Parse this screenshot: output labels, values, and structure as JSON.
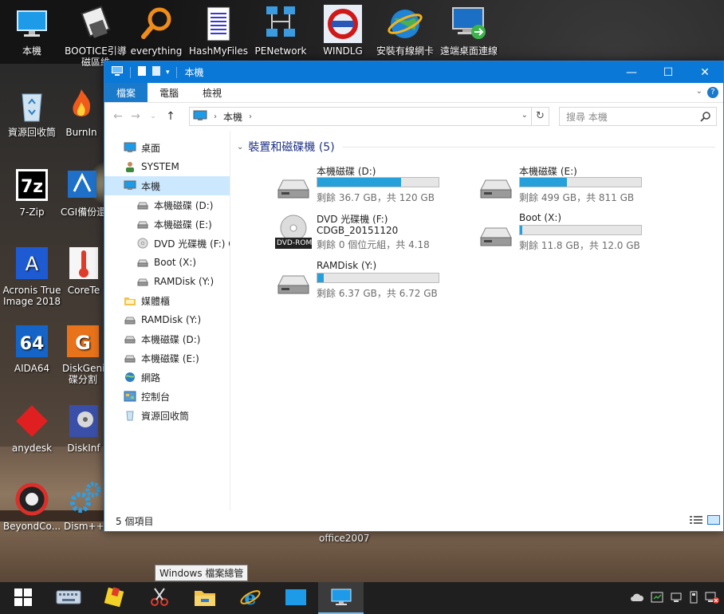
{
  "desktop": {
    "icons": [
      {
        "name": "this-pc",
        "label": "本機"
      },
      {
        "name": "bootice",
        "label": "BOOTICE引導磁區維"
      },
      {
        "name": "everything",
        "label": "everything"
      },
      {
        "name": "hashmyfiles",
        "label": "HashMyFiles"
      },
      {
        "name": "penetwork",
        "label": "PENetwork"
      },
      {
        "name": "windlg",
        "label": "WINDLG"
      },
      {
        "name": "install-nic",
        "label": "安裝有線網卡"
      },
      {
        "name": "remote-desktop",
        "label": "遠端桌面連線"
      },
      {
        "name": "recycle-bin",
        "label": "資源回收筒"
      },
      {
        "name": "burnin",
        "label": "BurnIn"
      },
      {
        "name": "7zip",
        "label": "7-Zip"
      },
      {
        "name": "cgi-backup",
        "label": "CGI備份還"
      },
      {
        "name": "acronis",
        "label": "Acronis True Image 2018"
      },
      {
        "name": "coretemp",
        "label": "CoreTe"
      },
      {
        "name": "aida64",
        "label": "AIDA64"
      },
      {
        "name": "diskgenius",
        "label": "DiskGeni 碟分割"
      },
      {
        "name": "anydesk",
        "label": "anydesk"
      },
      {
        "name": "diskinfo",
        "label": "DiskInf"
      },
      {
        "name": "beyondcompare",
        "label": "BeyondCo..."
      },
      {
        "name": "dism",
        "label": "Dism++"
      }
    ],
    "extra_label": "office2007",
    "tooltip": "Windows 檔案總管"
  },
  "explorer": {
    "title": "本機",
    "window_controls": {
      "minimize": "—",
      "maximize": "☐",
      "close": "✕"
    },
    "ribbon_tabs": [
      {
        "label": "檔案",
        "active": true
      },
      {
        "label": "電腦",
        "active": false
      },
      {
        "label": "檢視",
        "active": false
      }
    ],
    "address": {
      "crumb": "本機",
      "chevron": "›"
    },
    "search": {
      "placeholder": "搜尋 本機"
    },
    "nav": [
      {
        "label": "桌面",
        "icon": "desktop",
        "indent": 0,
        "selected": false
      },
      {
        "label": "SYSTEM",
        "icon": "user",
        "indent": 0,
        "selected": false
      },
      {
        "label": "本機",
        "icon": "pc",
        "indent": 0,
        "selected": true
      },
      {
        "label": "本機磁碟 (D:)",
        "icon": "drive",
        "indent": 1,
        "selected": false
      },
      {
        "label": "本機磁碟 (E:)",
        "icon": "drive",
        "indent": 1,
        "selected": false
      },
      {
        "label": "DVD 光碟機 (F:) C",
        "icon": "dvd",
        "indent": 1,
        "selected": false
      },
      {
        "label": "Boot (X:)",
        "icon": "drive",
        "indent": 1,
        "selected": false
      },
      {
        "label": "RAMDisk (Y:)",
        "icon": "drive",
        "indent": 1,
        "selected": false
      },
      {
        "label": "媒體櫃",
        "icon": "library",
        "indent": 0,
        "selected": false
      },
      {
        "label": "RAMDisk (Y:)",
        "icon": "drive",
        "indent": 0,
        "selected": false
      },
      {
        "label": "本機磁碟 (D:)",
        "icon": "drive",
        "indent": 0,
        "selected": false
      },
      {
        "label": "本機磁碟 (E:)",
        "icon": "drive",
        "indent": 0,
        "selected": false
      },
      {
        "label": "網路",
        "icon": "network",
        "indent": 0,
        "selected": false
      },
      {
        "label": "控制台",
        "icon": "control",
        "indent": 0,
        "selected": false
      },
      {
        "label": "資源回收筒",
        "icon": "recycle",
        "indent": 0,
        "selected": false
      }
    ],
    "group_title": "裝置和磁碟機 (5)",
    "drives": [
      {
        "name": "本機磁碟 (D:)",
        "info": "剩餘 36.7 GB，共 120 GB",
        "used_fraction": 0.694
      },
      {
        "name": "本機磁碟 (E:)",
        "info": "剩餘 499 GB，共 811 GB",
        "used_fraction": 0.385
      },
      {
        "name": "DVD 光碟機 (F:)",
        "sub": "CDGB_20151120",
        "info": "剩餘 0 個位元組，共 4.18",
        "badge": "DVD-ROM"
      },
      {
        "name": "Boot (X:)",
        "info": "剩餘 11.8 GB，共 12.0 GB",
        "used_fraction": 0.017
      },
      {
        "name": "RAMDisk (Y:)",
        "info": "剩餘 6.37 GB，共 6.72 GB",
        "used_fraction": 0.052
      }
    ],
    "status": "5 個項目"
  },
  "taskbar": {
    "buttons": [
      "start-icon",
      "keyboard-icon",
      "pe-tools-icon",
      "snipping-icon",
      "file-explorer-icon",
      "ie-icon",
      "blue-window-icon",
      "this-pc-icon"
    ]
  },
  "colors": {
    "titlebar": "#0a78d7",
    "accent": "#1979ca",
    "drive_fill": "#26a0da",
    "nav_selected": "#cce8ff",
    "group_title": "#1e3287"
  }
}
